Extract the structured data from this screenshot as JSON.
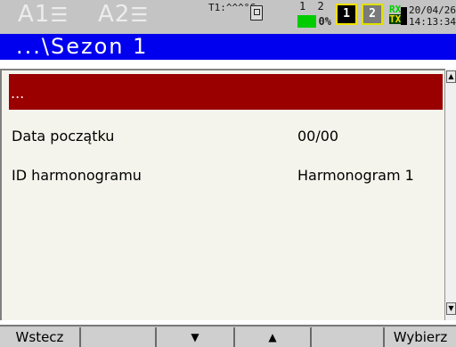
{
  "status_bar": {
    "channel_a1": "A1",
    "channel_a2": "A2",
    "temperature": "T1:^^^°C",
    "channels_label": "1 2",
    "progress_text": "0%",
    "progress_fraction": 0.55,
    "box1_label": "1",
    "box2_label": "2",
    "rx_label": "RX",
    "tx_label": "TX",
    "date": "20/04/26",
    "time": "14:13:34"
  },
  "title": "...\\Sezon 1",
  "selected_item": "...",
  "rows": [
    {
      "label": "Data początku",
      "value": "00/00"
    },
    {
      "label": "ID harmonogramu",
      "value": "Harmonogram 1"
    }
  ],
  "softkeys": {
    "back": "Wstecz",
    "key2": "",
    "down": "▼",
    "up": "▲",
    "key5": "",
    "select": "Wybierz"
  },
  "icons": {
    "sd_card": "sd-card-icon",
    "scroll_up": "arrow-up-icon",
    "scroll_down": "arrow-down-icon"
  },
  "colors": {
    "title_bar": "#0000ee",
    "selection": "#9a0000",
    "progress": "#00cc00"
  }
}
